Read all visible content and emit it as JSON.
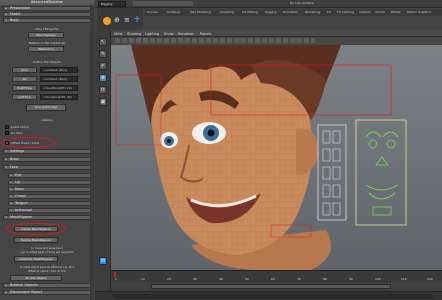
{
  "left_panel": {
    "title": "AdvancedSkeleton",
    "frames_top": [
      "Preparation",
      "Model",
      "Body"
    ],
    "face_setup": {
      "heading": "Face Fitting File",
      "load_label": "Main Eyes(s)",
      "ref_heading": "Reference file (Optional)",
      "reference_button": "Reference",
      "define_heading": "Define the Objects",
      "rows": [
        {
          "label": "Skin",
          "value": "<untitled>Body"
        },
        {
          "label": "All",
          "value": "<untitled>Body"
        },
        {
          "label": "Right Eye",
          "value": "<face|face|RE1 (Sh"
        },
        {
          "label": "Left Eye",
          "value": "<face|face|LE1 (Sh"
        }
      ],
      "one_point_button": "One point map"
    },
    "options": {
      "heading": "Options",
      "items": [
        "paste ctrl(s)",
        "Do Skin",
        "Offset Head / Adds"
      ]
    },
    "frames_mid": [
      "Settings",
      "Brow",
      "Face",
      "Eye",
      "Lip",
      "Nose",
      "Cheek",
      "Tongue",
      "Individual",
      "MeshRigaver"
    ],
    "create_button": "Create MeshRigaver",
    "delete_button": "Delete MeshRigaver",
    "note1": "to move and scale head",
    "note2": "just re-offset parts of body get upgraded",
    "optimize_button": "Optimize MeshRigaver",
    "note3": "to make object pose be effective e.g. face",
    "note4": "Offset to object - Turn on this",
    "frames_bottom": [
      "Fix the Object",
      "Refresh Objects",
      "Disconnect Object"
    ]
  },
  "top_menu": {
    "mode": "Rigging",
    "field": "No Live Surface"
  },
  "shelf_tabs": [
    "Curves",
    "Surfaces",
    "Poly Modeling",
    "Sculpting",
    "UV Editing",
    "Rigging",
    "Animation",
    "Rendering",
    "FX",
    "FX Caching",
    "Custom",
    "Arnold",
    "Bifrost",
    "Motion Graphics"
  ],
  "viewport_menu": [
    "View",
    "Shading",
    "Lighting",
    "Show",
    "Renderer",
    "Panels"
  ],
  "timeline": {
    "ticks": [
      "1",
      "10",
      "20",
      "30",
      "40",
      "50",
      "60",
      "70",
      "80",
      "90",
      "100",
      "110",
      "120"
    ]
  },
  "colors": {
    "highlight_ring": "#e0161e",
    "accent_green": "#7fd45a",
    "skin": "#c98a5c"
  }
}
